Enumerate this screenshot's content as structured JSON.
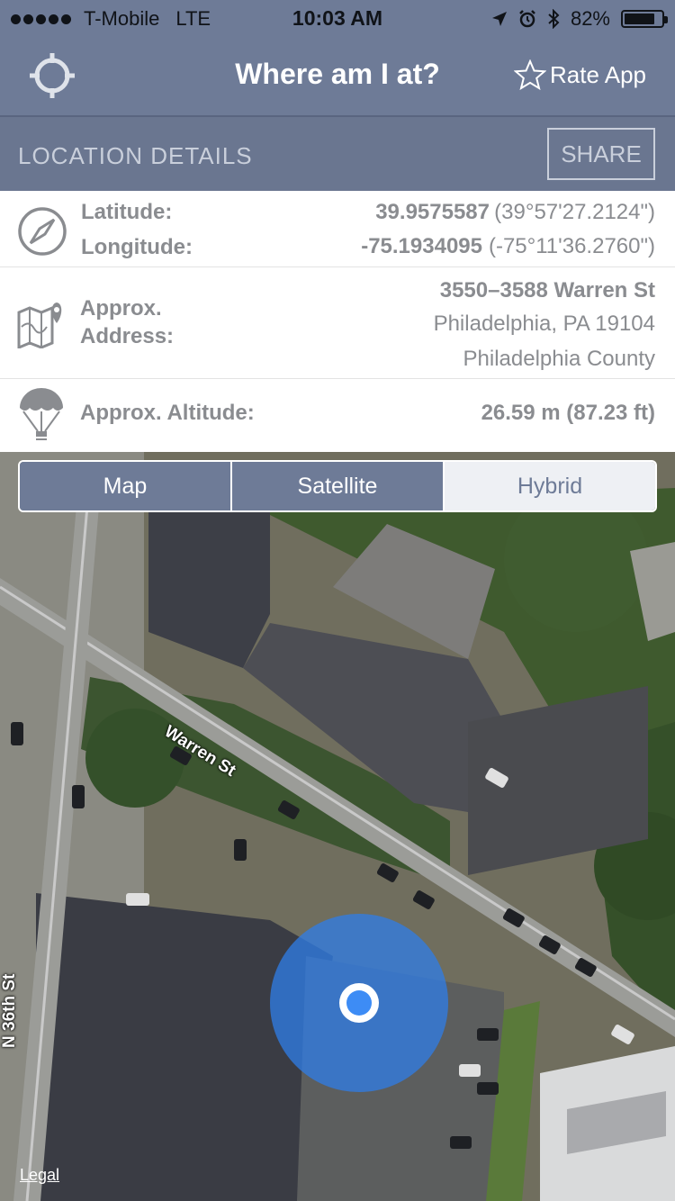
{
  "status_bar": {
    "carrier": "T-Mobile",
    "network": "LTE",
    "time": "10:03 AM",
    "battery": "82%",
    "battery_level": 0.82
  },
  "nav": {
    "title": "Where am I at?",
    "rate_label": "Rate App"
  },
  "section": {
    "title": "LOCATION DETAILS",
    "share_label": "SHARE"
  },
  "coordinates": {
    "latitude_label": "Latitude:",
    "latitude_value": "39.9575587",
    "latitude_dms": "(39°57'27.2124\")",
    "longitude_label": "Longitude:",
    "longitude_value": "-75.1934095",
    "longitude_dms": "(-75°11'36.2760\")"
  },
  "address": {
    "label_line1": "Approx.",
    "label_line2": "Address:",
    "street": "3550–3588 Warren St",
    "city": "Philadelphia, PA 19104",
    "county": "Philadelphia County"
  },
  "altitude": {
    "label": "Approx. Altitude:",
    "value": "26.59 m (87.23 ft)"
  },
  "map": {
    "modes": [
      "Map",
      "Satellite",
      "Hybrid"
    ],
    "selected_mode": "Hybrid",
    "streets": [
      "Warren St",
      "N 36th St"
    ],
    "legal": "Legal"
  },
  "colors": {
    "nav_bar": "#6e7b97",
    "location_dot": "#3d8cf5",
    "accuracy_circle": "#2f7de8"
  },
  "icons": [
    "crosshair-icon",
    "star-icon",
    "compass-icon",
    "map-pin-icon",
    "balloon-icon",
    "location-arrow-icon",
    "alarm-icon",
    "bluetooth-icon"
  ]
}
